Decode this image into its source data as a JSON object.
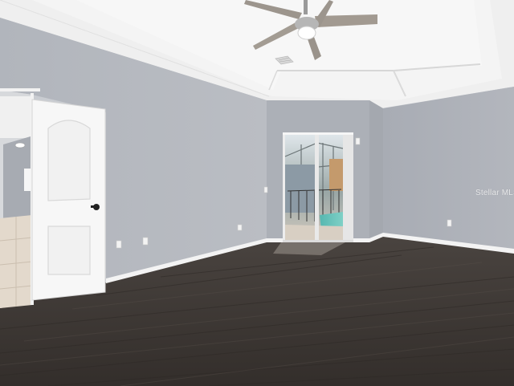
{
  "photo": {
    "subject": "empty-room-with-sliding-door",
    "watermark": "Stellar MLS"
  },
  "colors": {
    "ceiling": "#f1f1f1",
    "wall_left": "#b4b8bf",
    "wall_back": "#adb1b8",
    "wall_right": "#aeb2b9",
    "floor": "#3d3733",
    "baseboard": "#f4f4f4",
    "door": "#f7f7f7"
  },
  "icons": [
    "ceiling-fan-icon",
    "door-handle-icon",
    "outlet-icon",
    "light-switch-icon",
    "air-vent-icon"
  ]
}
